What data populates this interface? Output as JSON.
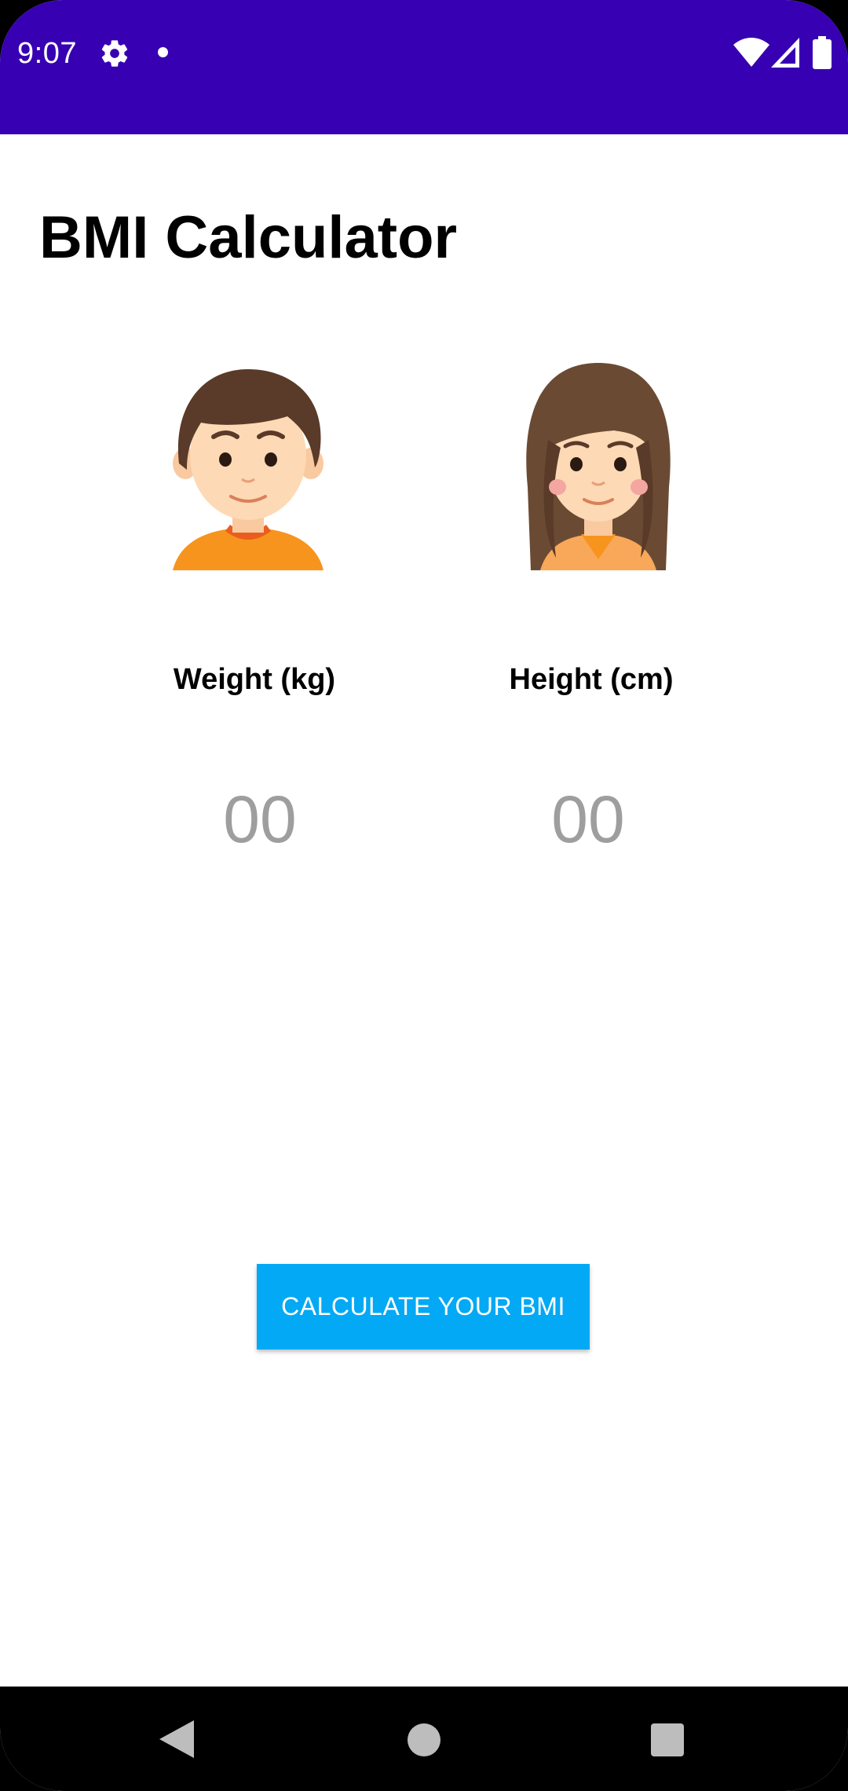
{
  "status_bar": {
    "time": "9:07",
    "icons": [
      "settings-icon",
      "notification-dot-icon",
      "wifi-icon",
      "cell-signal-icon",
      "battery-icon"
    ],
    "background": "#3700B3"
  },
  "page": {
    "title": "BMI Calculator"
  },
  "avatars": {
    "male": "male-avatar",
    "female": "female-avatar"
  },
  "weight": {
    "label": "Weight (kg)",
    "value": "00"
  },
  "height": {
    "label": "Height (cm)",
    "value": "00"
  },
  "action": {
    "calculate_label": "CALCULATE YOUR BMI",
    "color": "#03A9F4"
  },
  "navigation": {
    "icons": [
      "back-icon",
      "home-icon",
      "recents-icon"
    ]
  }
}
